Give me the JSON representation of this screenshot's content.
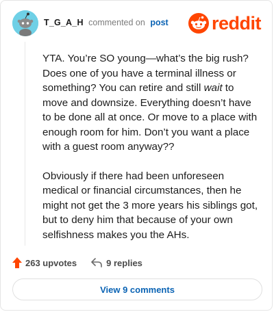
{
  "header": {
    "username": "T_G_A_H",
    "commented_text": "commented on",
    "post_link": "post",
    "logo_text": "reddit",
    "brand_color": "#ff4500",
    "avatar_color": "#6fd0e6"
  },
  "comment": {
    "p1_a": "YTA. You’re SO young—what’s the big rush? Does one of you have a terminal illness or something? You can retire and still ",
    "p1_em": "wait",
    "p1_b": " to move and downsize. Everything doesn’t have to be done all at once. Or move to a place with enough room for him. Don’t you want a place with a guest room anyway??",
    "p2": "Obviously if there had been unforeseen medical or financial circumstances, then he might not get the 3 more years his siblings got, but to deny him that because of your own selfishness makes you the AHs."
  },
  "actions": {
    "upvotes": "263 upvotes",
    "replies": "9 replies",
    "upvote_icon": "upvote-arrow-icon",
    "reply_icon": "reply-arrow-icon"
  },
  "footer": {
    "view_comments": "View 9 comments"
  }
}
